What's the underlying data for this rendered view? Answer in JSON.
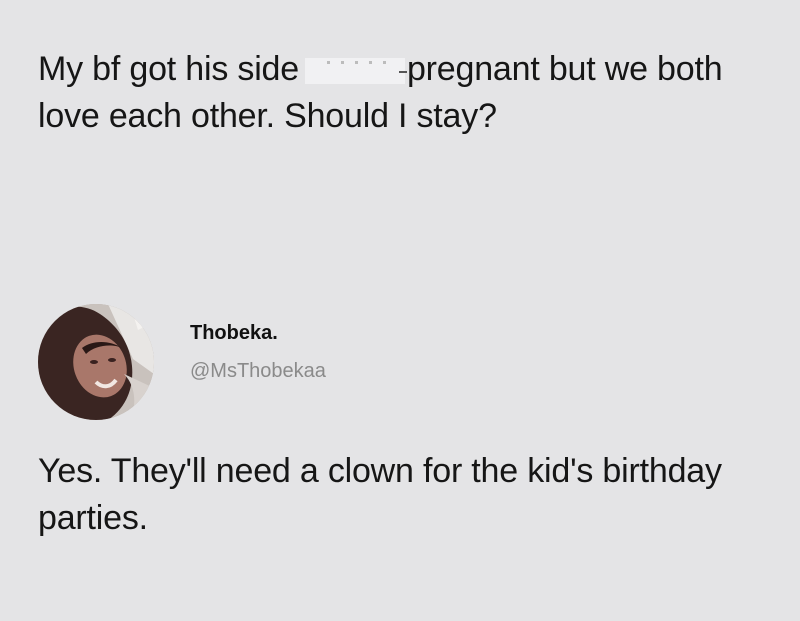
{
  "post": {
    "question_before": "My bf got his side",
    "question_after": "pregnant but we both love each other. Should I stay?"
  },
  "reply": {
    "display_name": "Thobeka.",
    "handle": "@MsThobekaa",
    "avatar_icon": "profile-photo-avatar",
    "text": "Yes. They'll need a clown for the kid's birthday parties."
  },
  "colors": {
    "background": "#e4e4e6",
    "text": "#161616",
    "handle": "#8a8a8a"
  }
}
